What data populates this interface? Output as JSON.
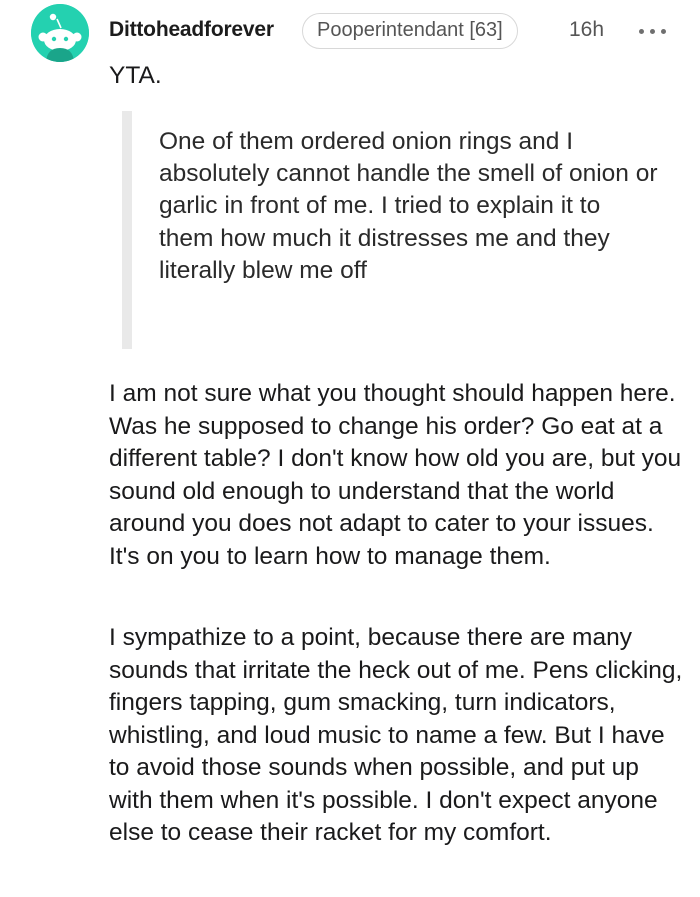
{
  "comment": {
    "username": "Dittoheadforever",
    "flair": "Pooperintendant [63]",
    "timestamp": "16h",
    "more_icon": "more-horizontal-icon",
    "avatar_color": "#24d1b0",
    "body": {
      "verdict": "YTA.",
      "quote": "One of them ordered onion rings and I absolutely cannot handle the smell of onion or garlic in front of me. I tried to explain it to them how much it distresses me and they literally blew me off",
      "paragraph_1": "I am not sure what you thought should happen here. Was he supposed to change his order? Go eat at a different table? I don't know how old you are, but you sound old enough to understand that the world around you does not adapt to cater to your issues. It's on you to learn how to manage them.",
      "paragraph_2": "I sympathize to a point, because there are many sounds that irritate the heck out of me. Pens clicking, fingers tapping, gum smacking, turn indicators, whistling, and loud music to name a few. But I have to avoid those sounds when possible, and put up with them when it's possible. I don't expect anyone else to cease their racket for my comfort."
    }
  }
}
